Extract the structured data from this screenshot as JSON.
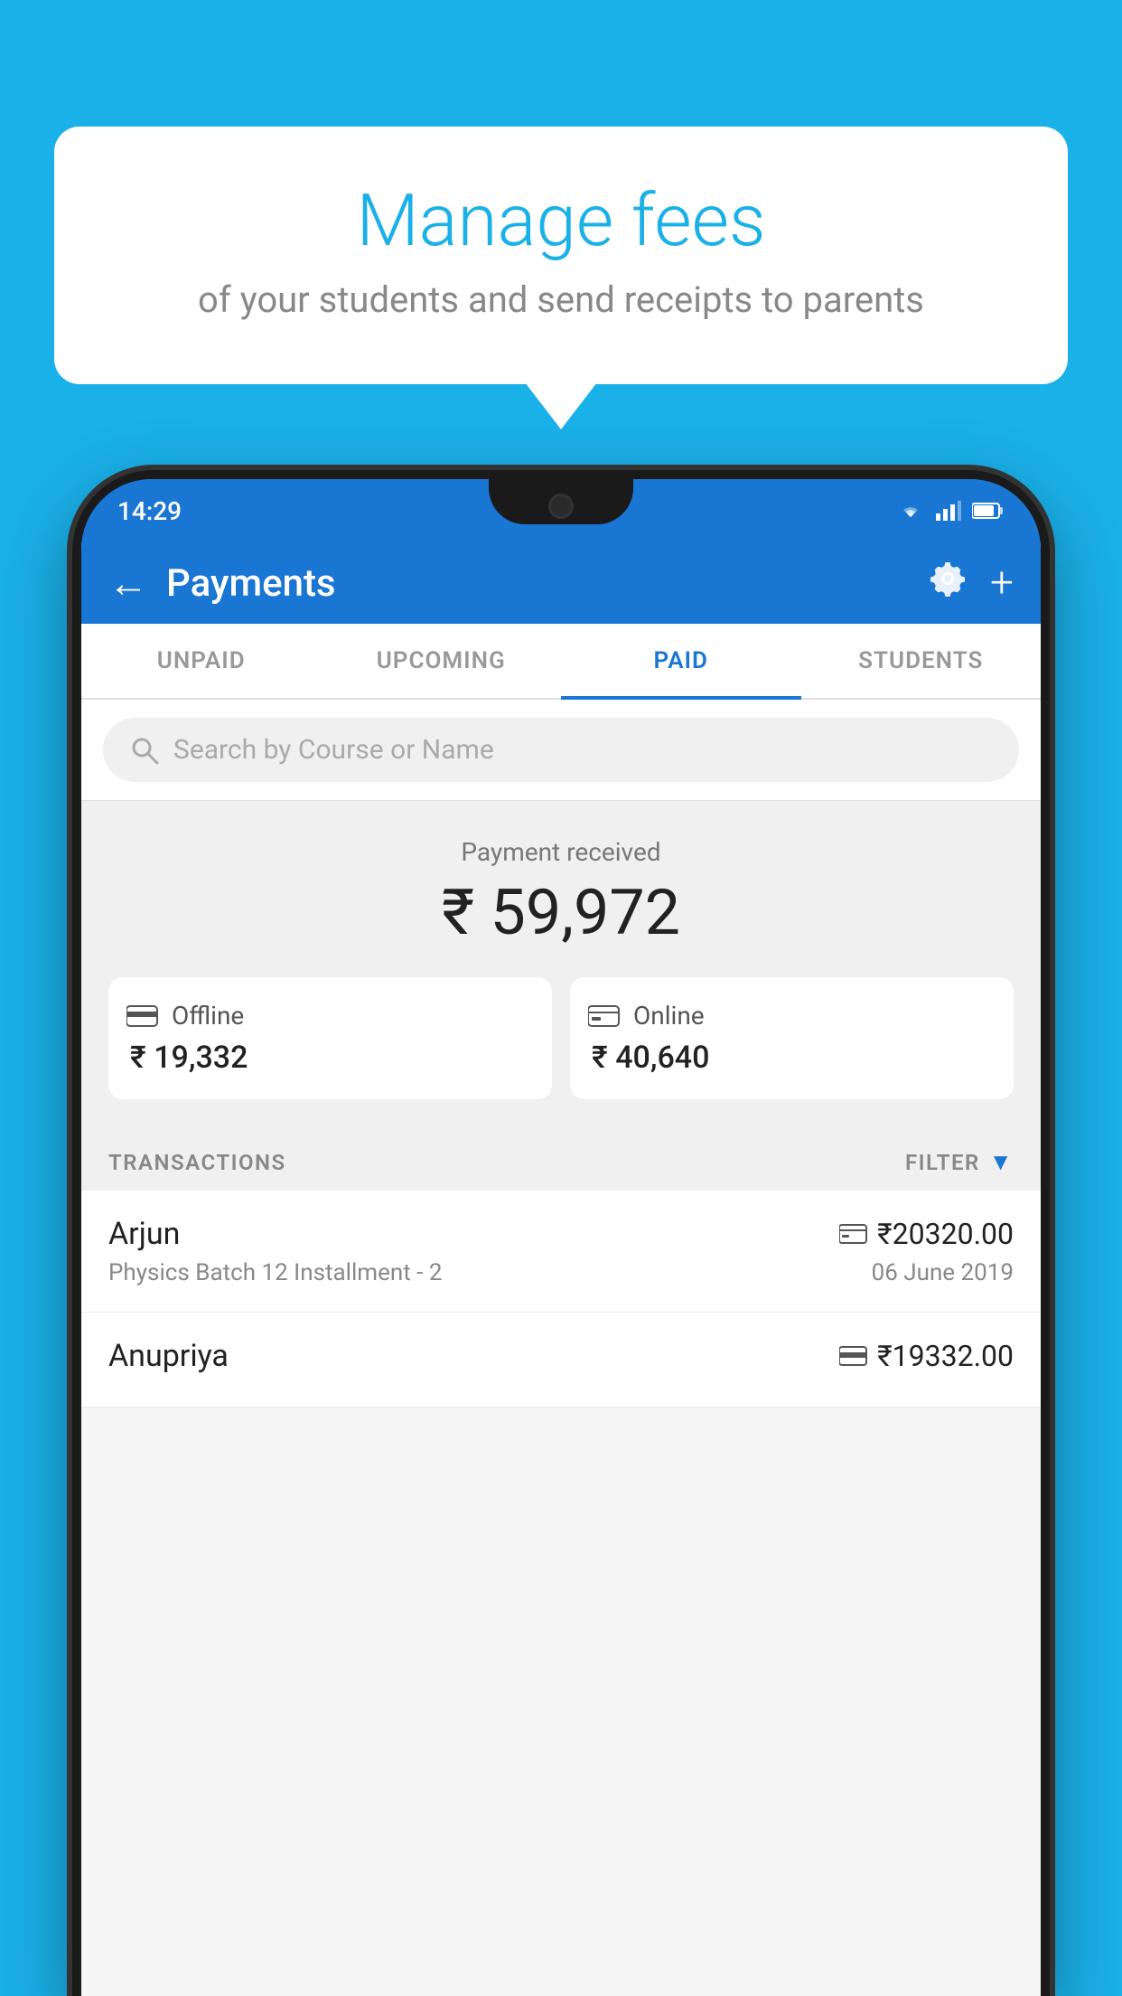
{
  "background_color": "#1ab0e8",
  "bubble": {
    "title": "Manage fees",
    "subtitle": "of your students and send receipts to parents"
  },
  "status_bar": {
    "time": "14:29",
    "wifi_icon": "wifi",
    "signal_icon": "signal",
    "battery_icon": "battery"
  },
  "top_bar": {
    "title": "Payments",
    "back_label": "←",
    "gear_label": "⚙",
    "plus_label": "+"
  },
  "tabs": [
    {
      "id": "unpaid",
      "label": "UNPAID",
      "active": false
    },
    {
      "id": "upcoming",
      "label": "UPCOMING",
      "active": false
    },
    {
      "id": "paid",
      "label": "PAID",
      "active": true
    },
    {
      "id": "students",
      "label": "STUDENTS",
      "active": false
    }
  ],
  "search": {
    "placeholder": "Search by Course or Name"
  },
  "payment_received": {
    "label": "Payment received",
    "amount": "₹ 59,972",
    "offline": {
      "icon": "💳",
      "label": "Offline",
      "amount": "₹ 19,332"
    },
    "online": {
      "icon": "💳",
      "label": "Online",
      "amount": "₹ 40,640"
    }
  },
  "transactions": {
    "label": "TRANSACTIONS",
    "filter_label": "FILTER",
    "rows": [
      {
        "name": "Arjun",
        "amount": "₹20320.00",
        "payment_icon": "💳",
        "course": "Physics Batch 12 Installment - 2",
        "date": "06 June 2019"
      },
      {
        "name": "Anupriya",
        "amount": "₹19332.00",
        "payment_icon": "💳",
        "course": "",
        "date": ""
      }
    ]
  }
}
